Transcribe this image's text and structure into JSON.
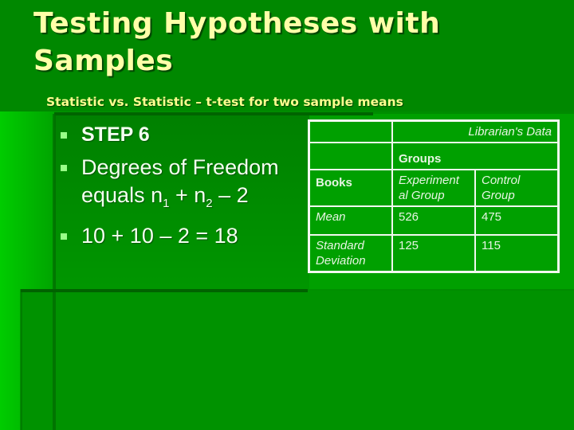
{
  "slide": {
    "title": "Testing Hypotheses with Samples",
    "subtitle": "Statistic vs. Statistic – t-test for two sample means",
    "bullets": [
      {
        "text": "STEP 6"
      },
      {
        "text_prefix": "Degrees of Freedom equals n",
        "sub1": "1",
        "mid": " + n",
        "sub2": "2",
        "suffix": " – 2"
      },
      {
        "text": "10 + 10 – 2 = 18"
      }
    ],
    "table": {
      "caption": "Librarian's Data",
      "group_header": "Groups",
      "row_header_label": "Books",
      "columns": [
        "Experimental Group",
        "Control Group"
      ],
      "columns_display": [
        "Experiment al Group",
        "Control Group"
      ],
      "rows": [
        {
          "label": "Mean",
          "values": [
            "526",
            "475"
          ]
        },
        {
          "label": "Standard Deviation",
          "values": [
            "125",
            "115"
          ]
        }
      ]
    },
    "colors": {
      "background": "#009200",
      "title": "#ffffa8",
      "subtitle": "#ffff90",
      "bullet": "#99ff88",
      "text": "#f4fff0"
    }
  }
}
